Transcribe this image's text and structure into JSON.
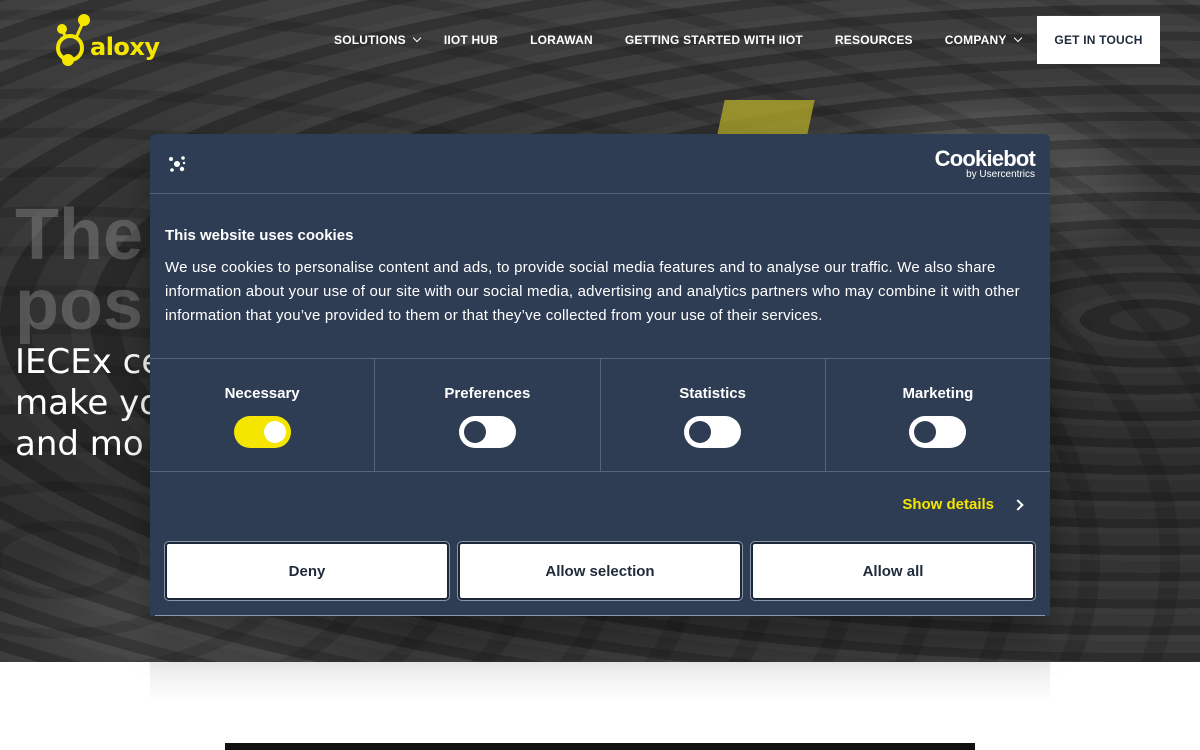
{
  "nav": {
    "logo_text": "aloxy",
    "links": [
      {
        "label": "SOLUTIONS",
        "has_dropdown": true
      },
      {
        "label": "IIOT HUB",
        "has_dropdown": false
      },
      {
        "label": "LORAWAN",
        "has_dropdown": false
      },
      {
        "label": "GETTING STARTED WITH IIOT",
        "has_dropdown": false
      },
      {
        "label": "RESOURCES",
        "has_dropdown": false
      },
      {
        "label": "COMPANY",
        "has_dropdown": true
      }
    ],
    "cta_label": "GET IN TOUCH"
  },
  "hero": {
    "title_line1": "The",
    "title_line2": "pos",
    "subtitle_line1": "IECEx ce",
    "subtitle_line2": "make yo",
    "subtitle_line3": "and mo"
  },
  "cookie_dialog": {
    "brand": "Cookiebot",
    "brand_by": "by Usercentrics",
    "title": "This website uses cookies",
    "text": "We use cookies to personalise content and ads, to provide social media features and to analyse our traffic. We also share information about your use of our site with our social media, advertising and analytics partners who may combine it with other information that you’ve provided to them or that they’ve collected from your use of their services.",
    "categories": [
      {
        "label": "Necessary",
        "enabled": true
      },
      {
        "label": "Preferences",
        "enabled": false
      },
      {
        "label": "Statistics",
        "enabled": false
      },
      {
        "label": "Marketing",
        "enabled": false
      }
    ],
    "show_details": "Show details",
    "buttons": {
      "deny": "Deny",
      "allow_selection": "Allow selection",
      "allow_all": "Allow all"
    }
  },
  "colors": {
    "brand_yellow": "#f5e600",
    "dialog_bg": "#2e3d54",
    "cta_text": "#1e2b3a"
  },
  "icons": {
    "logo": "aloxy-logo-icon",
    "dropdown": "chevron-down-icon",
    "usercentrics": "usercentrics-icon",
    "details": "chevron-right-icon"
  }
}
